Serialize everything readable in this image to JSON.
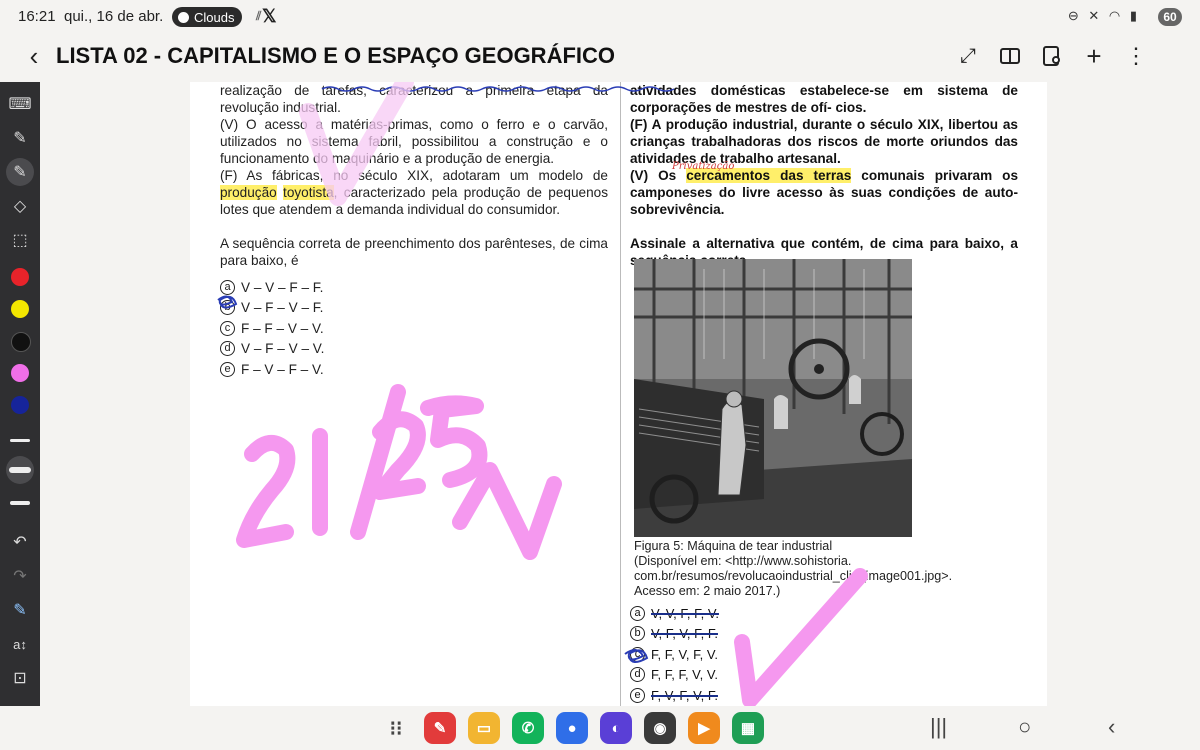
{
  "status": {
    "time": "16:21",
    "date": "qui., 16 de abr.",
    "media_pill": "Clouds",
    "battery": "60"
  },
  "header": {
    "title": "LISTA 02 - CAPITALISMO E O ESPAÇO GEOGRÁFICO"
  },
  "toolbar": {
    "colors": [
      "#e8232a",
      "#f3e600",
      "#111111",
      "#f06fe8",
      "#16249a"
    ]
  },
  "left_column": {
    "line0_a": "realização de tarefas",
    "line0_b": ", caracterizou a primeira etapa da revolução industrial.",
    "item2_mark": "(V)",
    "item2_text": " O acesso a matérias-primas, como o ferro e o carvão, utilizados no sistema fabril, possibilitou a construção e o funcionamento do maquinário e a produção de energia.",
    "item3_mark": "(F)",
    "item3_a": " As fábricas, no século XIX, adotaram um modelo de ",
    "item3_hl1": "produção",
    "item3_space": " ",
    "item3_hl2": "toyotista",
    "item3_b": ", caracterizado pela produção de pequenos lotes que atendem a demanda individual do consumidor.",
    "question": "A sequência correta de preenchimento dos parênteses, de cima para baixo, é",
    "options": [
      {
        "letter": "a",
        "text": "V – V – F – F."
      },
      {
        "letter": "b",
        "text": "V – F – V – F."
      },
      {
        "letter": "c",
        "text": "F – F – V – V."
      },
      {
        "letter": "d",
        "text": "V – F – V – V."
      },
      {
        "letter": "e",
        "text": "F – V – F – V."
      }
    ]
  },
  "right_column": {
    "line0": "atividades domésticas estabelece-se em sistema de corporações de mestres de ofí- cios.",
    "item_f_mark": "(F)",
    "item_f_text": " A produção industrial, durante o século XIX, libertou as crianças trabalhadoras dos riscos de morte oriundos das atividades de trabalho artesanal.",
    "item_v_mark": "(V)",
    "item_v_a": " Os ",
    "item_v_hl": "cercamentos das terras",
    "item_v_b": " comunais privaram os camponeses do livre acesso às suas condições de auto-sobrevivência.",
    "annotation_small": "Privatização",
    "question": "Assinale a alternativa que contém, de cima para baixo, a sequência correta.",
    "caption": [
      "Figura 5: Máquina de tear industrial",
      " (Disponível em: <http://www.sohistoria.",
      "com.br/resumos/revolucaoindustrial_clip_image001.jpg>.",
      "Acesso em: 2 maio 2017.)"
    ],
    "options": [
      {
        "letter": "a",
        "text": "V, V, F, F, V."
      },
      {
        "letter": "b",
        "text": "V, F, V, F, F."
      },
      {
        "letter": "c",
        "text": "F, F, V, F, V."
      },
      {
        "letter": "d",
        "text": "F, F, F, V, V."
      },
      {
        "letter": "e",
        "text": "F, V, F, V, F."
      }
    ]
  },
  "handwriting": {
    "score": "21/25"
  }
}
